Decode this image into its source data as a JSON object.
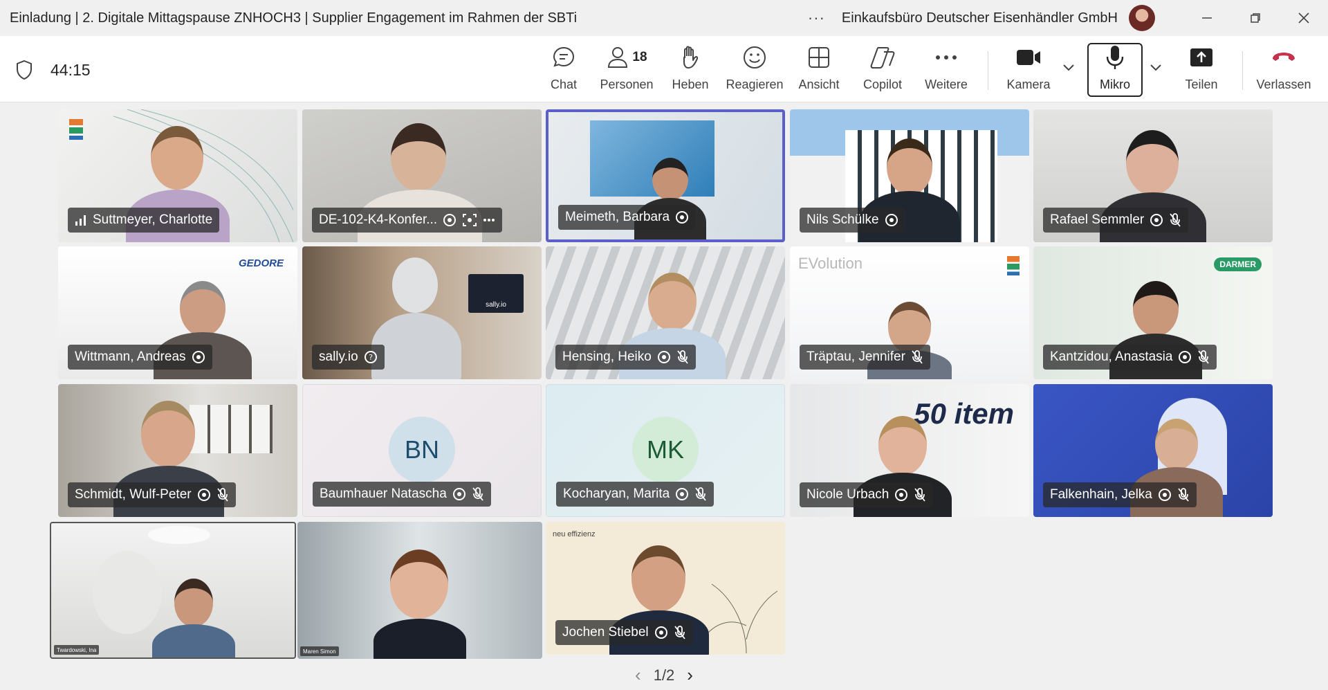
{
  "window": {
    "title": "Einladung | 2. Digitale Mittagspause ZNHOCH3 | Supplier Engagement im Rahmen der SBTi",
    "more": "···",
    "organization": "Einkaufsbüro Deutscher Eisenhändler GmbH"
  },
  "toolbar": {
    "timer": "44:15",
    "chat": "Chat",
    "people": "Personen",
    "people_count": "18",
    "raise": "Heben",
    "react": "Reagieren",
    "view": "Ansicht",
    "copilot": "Copilot",
    "more": "Weitere",
    "camera": "Kamera",
    "mic": "Mikro",
    "share": "Teilen",
    "leave": "Verlassen"
  },
  "tiles": [
    {
      "name": "Suttmeyer, Charlotte"
    },
    {
      "name": "DE-102-K4-Konfer..."
    },
    {
      "name": "Meimeth, Barbara"
    },
    {
      "name": "Nils Schülke"
    },
    {
      "name": "Rafael Semmler"
    },
    {
      "name": "Wittmann, Andreas",
      "logo": "GEDORE"
    },
    {
      "name": "sally.io",
      "logo": "sally.io"
    },
    {
      "name": "Hensing, Heiko"
    },
    {
      "name": "Träptau, Jennifer",
      "logo": "EVolution"
    },
    {
      "name": "Kantzidou, Anastasia",
      "logo": "DARMER"
    },
    {
      "name": "Schmidt, Wulf-Peter"
    },
    {
      "name": "Baumhauer Natascha",
      "initials": "BN"
    },
    {
      "name": "Kocharyan, Marita",
      "initials": "MK"
    },
    {
      "name": "Nicole Urbach",
      "logo": "50 item"
    },
    {
      "name": "Falkenhain, Jelka"
    },
    {
      "name": "Twardowski, Ina"
    },
    {
      "name": "Maren Simon"
    },
    {
      "name": "Jochen Stiebel",
      "logo": "neu effizienz"
    }
  ],
  "pager": {
    "label": "1/2"
  },
  "colors": {
    "accent": "#5b5fc7",
    "leave": "#c4314b"
  }
}
